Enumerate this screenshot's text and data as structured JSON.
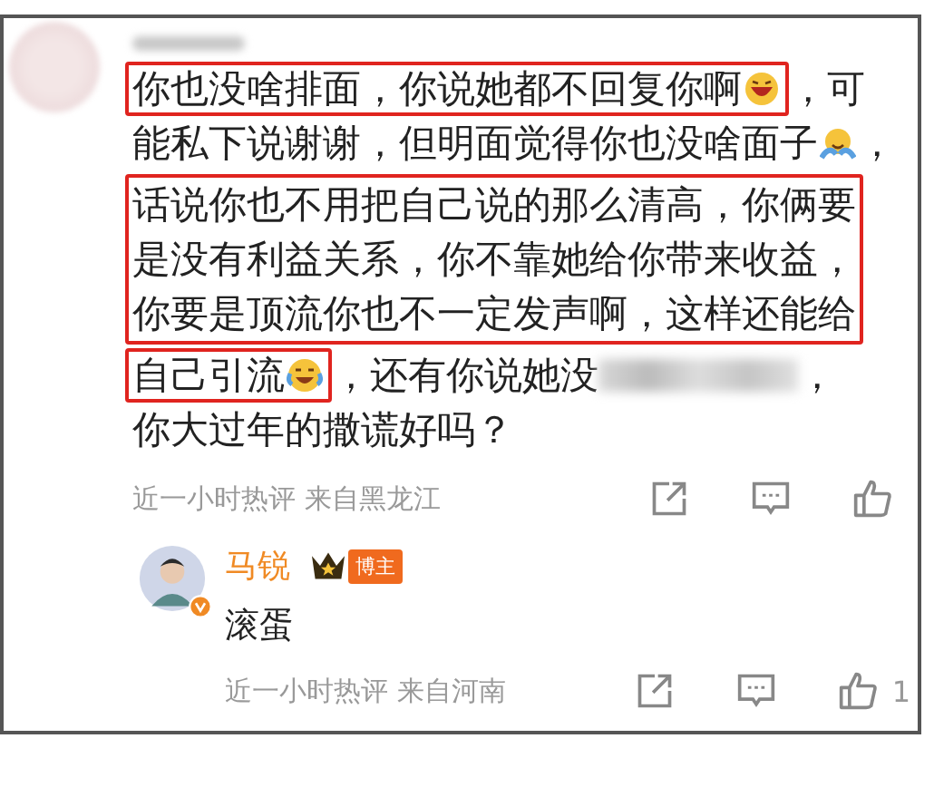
{
  "comment": {
    "blocks": [
      {
        "highlighted": false,
        "lines": [
          [
            {
              "highlighted": true,
              "parts": [
                {
                  "kind": "text",
                  "text": "你也没啥排面，你说她都不回复你啊"
                },
                {
                  "kind": "grin"
                }
              ]
            },
            {
              "highlighted": false,
              "parts": [
                {
                  "kind": "text",
                  "text": "，可"
                }
              ]
            }
          ],
          [
            {
              "highlighted": false,
              "parts": [
                {
                  "kind": "text",
                  "text": "能私下说谢谢，但明面觉得你也没啥面子"
                },
                {
                  "kind": "hug"
                },
                {
                  "kind": "text",
                  "text": "，"
                }
              ]
            }
          ]
        ]
      },
      {
        "highlighted": true,
        "lines": [
          [
            {
              "highlighted": false,
              "parts": [
                {
                  "kind": "text",
                  "text": "话说你也不用把自己说的那么清高，你俩要"
                }
              ]
            }
          ],
          [
            {
              "highlighted": false,
              "parts": [
                {
                  "kind": "text",
                  "text": "是没有利益关系，你不靠她给你带来收益，"
                }
              ]
            }
          ],
          [
            {
              "highlighted": false,
              "parts": [
                {
                  "kind": "text",
                  "text": "你要是顶流你也不一定发声啊，这样还能给"
                }
              ]
            }
          ]
        ]
      },
      {
        "highlighted": false,
        "lines": [
          [
            {
              "highlighted": true,
              "parts": [
                {
                  "kind": "text",
                  "text": "自己引流"
                },
                {
                  "kind": "tears"
                }
              ]
            },
            {
              "highlighted": false,
              "parts": [
                {
                  "kind": "text",
                  "text": "，还有你说她没"
                },
                {
                  "kind": "blur"
                },
                {
                  "kind": "text",
                  "text": "，"
                }
              ]
            }
          ],
          [
            {
              "highlighted": false,
              "parts": [
                {
                  "kind": "text",
                  "text": "你大过年的撒谎好吗？"
                }
              ]
            }
          ]
        ]
      }
    ],
    "meta": "近一小时热评 来自黑龙江"
  },
  "reply": {
    "name": "马锐",
    "badge": "博主",
    "text": "滚蛋",
    "meta": "近一小时热评 来自河南",
    "likes": "1"
  }
}
